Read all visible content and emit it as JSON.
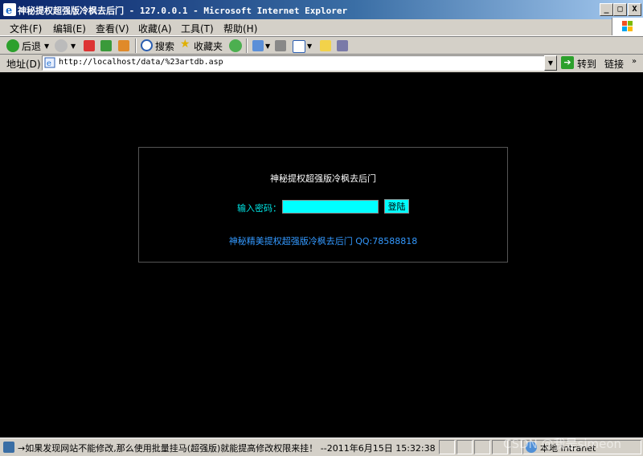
{
  "window": {
    "title": "神秘提权超强版冷枫去后门 - 127.0.0.1 - Microsoft Internet Explorer",
    "minimize": "_",
    "maximize": "□",
    "close": "X"
  },
  "menu": {
    "file": "文件(F)",
    "edit": "编辑(E)",
    "view": "查看(V)",
    "favorites": "收藏(A)",
    "tools": "工具(T)",
    "help": "帮助(H)"
  },
  "toolbar": {
    "back": "后退",
    "search": "搜索",
    "favorites": "收藏夹"
  },
  "address": {
    "label": "地址(D)",
    "url": "http://localhost/data/%23artdb.asp",
    "go": "转到",
    "links": "链接"
  },
  "page": {
    "title": "神秘提权超强版冷枫去后门",
    "password_label": "输入密码：",
    "password_value": "",
    "login_button": "登陆",
    "footer": "神秘精美提权超强版冷枫去后门 QQ:78588818"
  },
  "status": {
    "text": "→如果发现网站不能修改,那么使用批量挂马(超强版)就能提高修改权限来挂！ --2011年6月15日 15:32:38",
    "zone": "本地 Intranet"
  },
  "watermark": "CSDN @我是simeon",
  "colors": {
    "page_bg": "#000000",
    "input_bg": "#00ffff",
    "label_cyan": "#00e5e5",
    "footer_blue": "#3399ff"
  }
}
